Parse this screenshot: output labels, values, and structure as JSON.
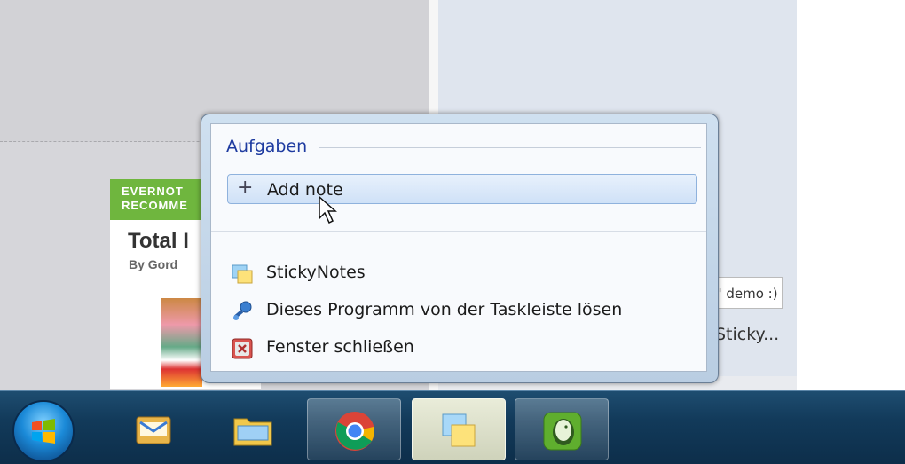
{
  "background": {
    "promo_banner_line1": "EVERNOT",
    "promo_banner_line2": "RECOMME",
    "promo_title": "Total I",
    "promo_by": "By Gord",
    "demo_tag": "' demo :)",
    "sticky_window_caption": "Sticky..."
  },
  "jumplist": {
    "header": "Aufgaben",
    "task": {
      "icon": "plus-icon",
      "label": "Add note"
    },
    "items": [
      {
        "icon": "stickynotes-app-icon",
        "label": "StickyNotes"
      },
      {
        "icon": "unpin-icon",
        "label": "Dieses Programm von der Taskleiste lösen"
      },
      {
        "icon": "close-window-icon",
        "label": "Fenster schließen"
      }
    ]
  },
  "taskbar": {
    "buttons": [
      {
        "icon": "start-orb-icon"
      },
      {
        "icon": "outlook-mail-icon"
      },
      {
        "icon": "file-explorer-icon"
      },
      {
        "icon": "chrome-icon"
      },
      {
        "icon": "stickynotes-icon"
      },
      {
        "icon": "evernote-icon"
      }
    ]
  },
  "colors": {
    "accent": "#1e3ba0",
    "promo_green": "#6fb63e",
    "taskbar": "#123a5a"
  }
}
